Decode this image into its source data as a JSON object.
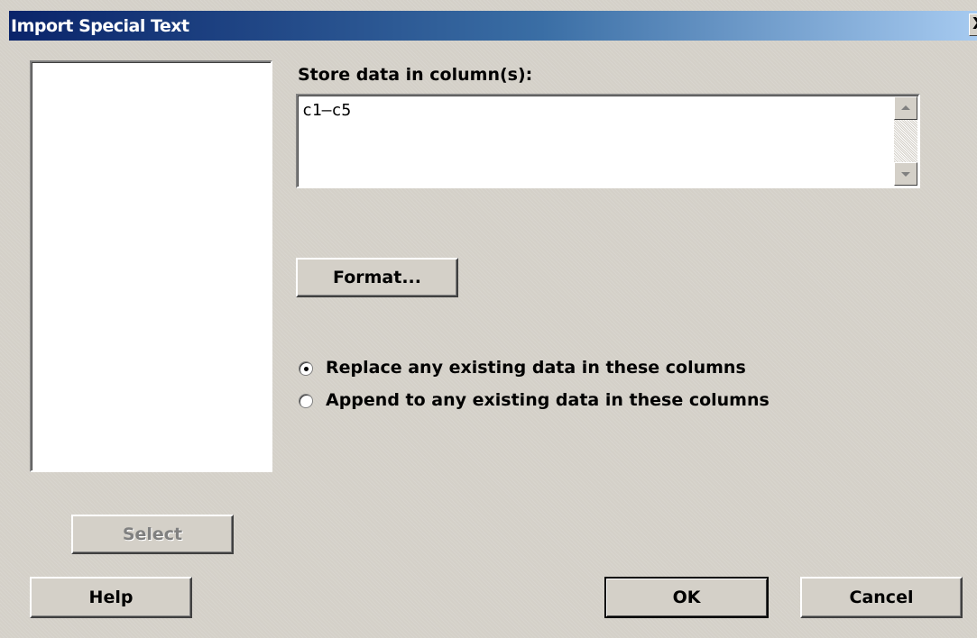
{
  "window": {
    "title": "Import Special Text",
    "close_glyph": "X"
  },
  "variables_list": {
    "items": []
  },
  "store": {
    "label": "Store data in column(s):",
    "value": "c1–c5"
  },
  "buttons": {
    "format": "Format...",
    "select": "Select",
    "help": "Help",
    "ok": "OK",
    "cancel": "Cancel"
  },
  "data_option": {
    "replace_label": "Replace any existing data in these columns",
    "append_label": "Append to any existing data in these columns",
    "selected": "replace"
  },
  "icons": {
    "scroll_up": "scroll-up-arrow-icon",
    "scroll_down": "scroll-down-arrow-icon",
    "close": "close-icon"
  },
  "colors": {
    "title_start": "#0a246a",
    "title_end": "#a6caf0",
    "face": "#d4d0c8"
  }
}
